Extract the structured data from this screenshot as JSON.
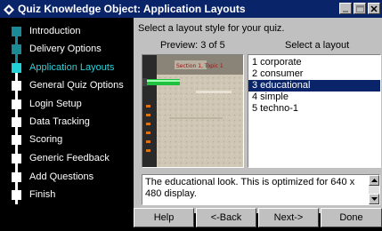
{
  "window": {
    "title": "Quiz Knowledge Object: Application Layouts",
    "minimize_icon": "minimize-icon",
    "maximize_icon": "maximize-icon",
    "close_icon": "close-icon"
  },
  "sidebar": {
    "steps": [
      {
        "label": "Introduction",
        "state": "done"
      },
      {
        "label": "Delivery Options",
        "state": "done"
      },
      {
        "label": "Application Layouts",
        "state": "active"
      },
      {
        "label": "General Quiz Options",
        "state": "pending"
      },
      {
        "label": "Login Setup",
        "state": "pending"
      },
      {
        "label": "Data Tracking",
        "state": "pending"
      },
      {
        "label": "Scoring",
        "state": "pending"
      },
      {
        "label": "Generic Feedback",
        "state": "pending"
      },
      {
        "label": "Add Questions",
        "state": "pending"
      },
      {
        "label": "Finish",
        "state": "pending"
      }
    ]
  },
  "main": {
    "instruction": "Select a layout style for your quiz.",
    "preview_label": "Preview: 3 of 5",
    "select_label": "Select a layout",
    "preview_image_text": "Section 1, Topic 1",
    "layouts": [
      "1 corporate",
      "2 consumer",
      "3 educational",
      "4 simple",
      "5 techno-1"
    ],
    "selected_layout": "3 educational",
    "description": "The educational look. This is optimized for 640 x 480 display."
  },
  "buttons": {
    "help": "Help",
    "back": "<-Back",
    "next": "Next->",
    "done": "Done"
  },
  "colors": {
    "titlebar": "#0a246a",
    "sidebar_bg": "#000000",
    "active_step": "#22d0d8",
    "done_step": "#1a8a96",
    "selection": "#0a246a"
  }
}
